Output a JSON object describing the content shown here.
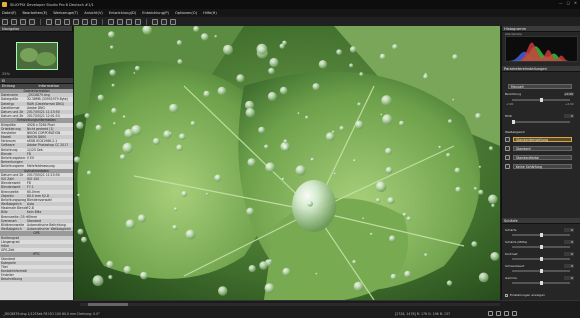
{
  "window": {
    "title": "SILKYPIX Developer Studio Pro 8 Deutsch  #1/1",
    "controls": [
      "—",
      "□",
      "✕"
    ]
  },
  "menu": [
    "Datei(F)",
    "Bearbeiten(E)",
    "Werkzeuge(T)",
    "Ansicht(V)",
    "Entwicklung(D)",
    "Entwicklung(P)",
    "Optionen(O)",
    "Hilfe(H)"
  ],
  "toolbar_icon_names": [
    "open-folder-icon",
    "save-icon",
    "undo-icon",
    "redo-icon",
    "rotate-left-icon",
    "rotate-right-icon",
    "grid-view-icon",
    "single-view-icon",
    "compare-icon",
    "fullscreen-icon",
    "crop-icon",
    "straighten-icon",
    "spot-icon",
    "brush-icon",
    "develop-icon",
    "print-icon",
    "zoom-icon"
  ],
  "navigator": {
    "header": "Navigator",
    "zoom": "25%"
  },
  "metadata": {
    "header": "Ei",
    "columns": [
      "Eintrag",
      "Information"
    ],
    "rows": [
      {
        "k": "",
        "v": "Dateiinformation",
        "grp": true
      },
      {
        "k": "Dateiname",
        "v": "_DSC8879.dng"
      },
      {
        "k": "Dateigröße",
        "v": "32.38MB (33951979 Byte)"
      },
      {
        "k": "Dateityp",
        "v": "RAW (Dateiformat DNG)"
      },
      {
        "k": "Dateiformat",
        "v": "Adobe DNG"
      },
      {
        "k": "Datum und Ze",
        "v": "2017/05/21 11:15:50"
      },
      {
        "k": "Datum und Ze",
        "v": "2017/05/21 12:01:53"
      },
      {
        "k": "",
        "v": "Entwicklungsinformation",
        "grp": true
      },
      {
        "k": "Bildgröße",
        "v": "4928 x 3264 Pixel"
      },
      {
        "k": "Orientierung",
        "v": "Nicht gedreht (1)"
      },
      {
        "k": "Hersteller",
        "v": "NIKON CORPORATION"
      },
      {
        "k": "Modell",
        "v": "NIKON D800"
      },
      {
        "k": "Farbraum",
        "v": "sRGB IEC61966-2.1"
      },
      {
        "k": "Software",
        "v": "Adobe Photoshop CC 2017"
      },
      {
        "k": "Belichtung",
        "v": "1/125 Sek."
      },
      {
        "k": "Blende",
        "v": "F8"
      },
      {
        "k": "Belichtungskorr.",
        "v": "0 EV"
      },
      {
        "k": "Bemerkungen",
        "v": ""
      },
      {
        "k": "Belichtungsme",
        "v": "Mehrfeldmessung"
      },
      {
        "k": "",
        "v": "Aufnahmedaten",
        "grp": true
      },
      {
        "k": "Datum und Ze",
        "v": "2017/05/21 11:15:50"
      },
      {
        "k": "ISO Zahl",
        "v": "ISO 100"
      },
      {
        "k": "Blendenwert",
        "v": "F8"
      },
      {
        "k": "Blendenwert",
        "v": "F7.1"
      },
      {
        "k": "Brennweite",
        "v": "60.0mm"
      },
      {
        "k": "Objektiv",
        "v": "60.0 mm f/2.8"
      },
      {
        "k": "Belichtungsprog",
        "v": "Blendenvorwahl"
      },
      {
        "k": "Weißabgleich",
        "v": "Auto"
      },
      {
        "k": "Maximale Blende",
        "v": "F2.8"
      },
      {
        "k": "Blitz",
        "v": "Kein Blitz"
      },
      {
        "k": "Brennweite (35 mm)",
        "v": "60mm"
      },
      {
        "k": "Szenenart",
        "v": "Standard"
      },
      {
        "k": "Bildbrennweite",
        "v": "Automatische Belichtung"
      },
      {
        "k": "Weißabgleich",
        "v": "Automatischer Weißabgleich"
      },
      {
        "k": "",
        "v": "GPS",
        "grp": true
      },
      {
        "k": "Breitengrad",
        "v": ""
      },
      {
        "k": "Längengrad",
        "v": ""
      },
      {
        "k": "Höhe",
        "v": ""
      },
      {
        "k": "GPS-Zeit",
        "v": ""
      },
      {
        "k": "",
        "v": "IPTC",
        "grp": true
      },
      {
        "k": "Standard",
        "v": ""
      },
      {
        "k": "Kategorie",
        "v": ""
      },
      {
        "k": "Titel",
        "v": ""
      },
      {
        "k": "Kontaktinformationen",
        "v": ""
      },
      {
        "k": "Ersteller",
        "v": ""
      },
      {
        "k": "Beschreibung",
        "v": ""
      }
    ]
  },
  "status": {
    "left": "_DSC8879.dng 1/125Sek F8 ISO 100 60.0 mm  Drehung: 0.0°",
    "right": "[2728, 1476]  R: 176 G: 196 B: 137"
  },
  "right_panel": {
    "histogram_header": "Histogramm",
    "channel_label": "Alle Kanäle",
    "params_header": "Parametereinstellungen",
    "preset_value": "Manuell",
    "exposure_label": "Belichtung",
    "exposure_value": "+0.00",
    "ev_min": "-2.00",
    "ev_max": "+2.00",
    "hdr_label": "HDR",
    "hdr_value": "0",
    "wb_label": "Weißabgleich",
    "wb_value": "Standardeinstellung",
    "tone_value": "Standard",
    "color_value": "Standardfarbe",
    "sharp_value": "Keine Schärfung",
    "sharpness_header": "Schärfe",
    "sliders": [
      {
        "label": "Schärfe",
        "value": "0"
      },
      {
        "label": "Schärfe (Mitte)",
        "value": "0"
      },
      {
        "label": "Kontrast",
        "value": "0"
      },
      {
        "label": "Schwarzwert",
        "value": "0"
      },
      {
        "label": "Gamma",
        "value": "0"
      }
    ],
    "checkbox_label": "Einstellungen anzeigen"
  },
  "colors": {
    "histogram_red": "#d23c3c",
    "histogram_green": "#3cc83c",
    "histogram_blue": "#4060e0"
  }
}
